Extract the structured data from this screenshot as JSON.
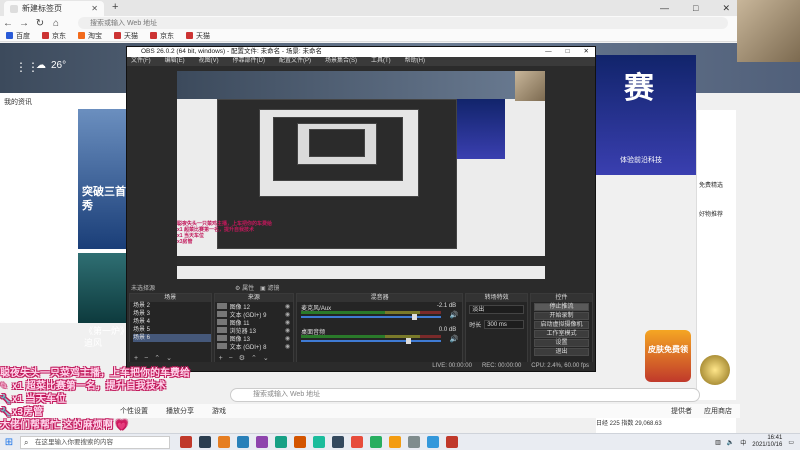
{
  "browser": {
    "tab_title": "新建标签页",
    "url_placeholder": "搜索或输入 Web 地址",
    "bookmarks": [
      "百度",
      "京东",
      "淘宝",
      "天猫",
      "京东",
      "天猫"
    ]
  },
  "page": {
    "weather_temp": "26°",
    "news_header": "我的资讯",
    "headline": "突破三首秀",
    "story_title": "《第一炉》追风",
    "ad_big_text": "赛",
    "ad_tag": "体验前沿科技",
    "right_snippets": [
      "免费精选",
      "好物推荐"
    ],
    "game_badge": "皮肤免费领",
    "search_placeholder": "搜索或输入 Web 地址",
    "bottom_items": [
      "个性设置",
      "播放分享",
      "游戏"
    ],
    "bottom_right": [
      "提供者",
      "应用商店"
    ],
    "table_text": "日经 225 指数 29,068.63"
  },
  "obs": {
    "title": "OBS 26.0.2 (64 bit, windows) - 配置文件: 未命名 - 场景: 未命名",
    "menu": [
      "文件(F)",
      "编辑(E)",
      "视图(V)",
      "停靠部件(D)",
      "配置文件(P)",
      "场景集合(S)",
      "工具(T)",
      "帮助(H)"
    ],
    "controls": [
      "—",
      "□",
      "✕"
    ],
    "docks": {
      "scenes": "场景",
      "sources": "来源",
      "mixer": "混音器",
      "transitions": "转场特效",
      "controls": "控件"
    },
    "no_source": "未选择源",
    "props_btn": "属性",
    "filters_btn": "滤镜",
    "scenes": [
      "场景 2",
      "场景 3",
      "场景 4",
      "场景 5",
      "场景 6"
    ],
    "sources": [
      {
        "name": "图像 12"
      },
      {
        "name": "文本 (GDI+) 9"
      },
      {
        "name": "图像 11"
      },
      {
        "name": "浏览器 13"
      },
      {
        "name": "图像 13"
      },
      {
        "name": "文本 (GDI+) 8"
      }
    ],
    "mixer": [
      {
        "name": "麦克风/Aux",
        "db": "-2.1 dB",
        "level": 0.82
      },
      {
        "name": "桌面音频",
        "db": "0.0 dB",
        "level": 0.78
      }
    ],
    "transition": "淡出",
    "duration_label": "时长",
    "duration": "300 ms",
    "control_buttons": [
      "停止推流",
      "开始录制",
      "启动虚拟摄像机",
      "工作室模式",
      "设置",
      "退出"
    ],
    "status": [
      "LIVE: 00:00:00",
      "REC: 00:00:00",
      "CPU: 2.4%, 60.00 fps"
    ]
  },
  "overlay": {
    "lines": [
      "聪夜失头一只菜鸡主播，上车把你的车费给",
      "x1 超菜比赛第一名，提升自我技术",
      "x1 当天车位",
      "x3房管",
      "大佬们帮帮忙 这的麻烦啊 💗"
    ]
  },
  "taskbar": {
    "search_placeholder": "在这里输入你要搜索的内容",
    "time": "16:41",
    "date": "2021/10/16",
    "tray_text": "中",
    "app_colors": [
      "#c0392b",
      "#2c3e50",
      "#e67e22",
      "#2980b9",
      "#8e44ad",
      "#16a085",
      "#d35400",
      "#1abc9c",
      "#34495e",
      "#e74c3c",
      "#27ae60",
      "#f39c12",
      "#7f8c8d",
      "#3498db",
      "#c0392b"
    ]
  }
}
